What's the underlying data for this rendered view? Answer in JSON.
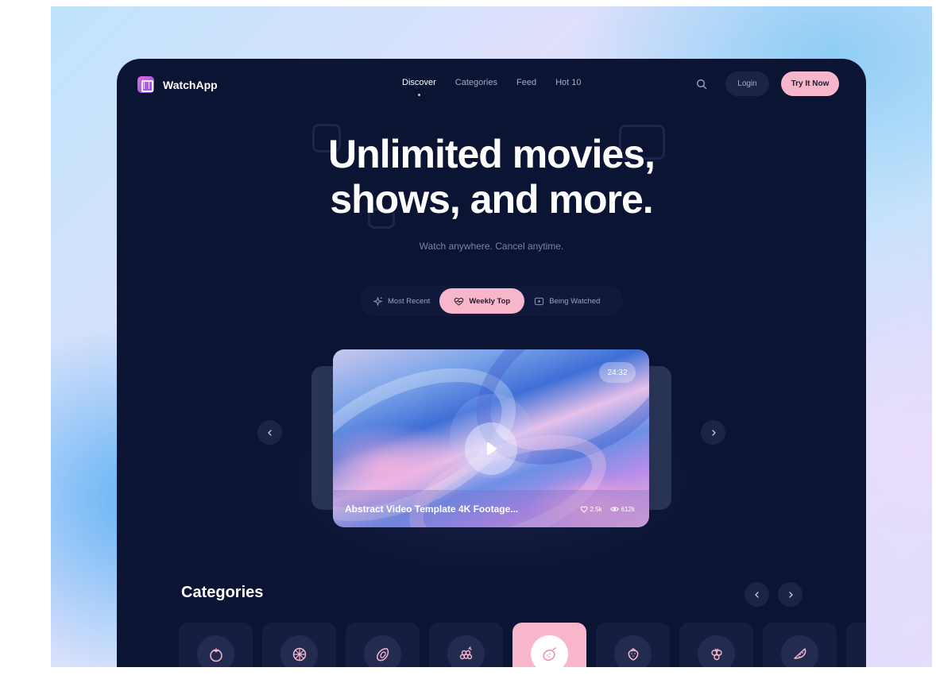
{
  "brand": {
    "name": "WatchApp",
    "icon": "film-icon"
  },
  "nav": {
    "items": [
      {
        "label": "Discover",
        "active": true
      },
      {
        "label": "Categories",
        "active": false
      },
      {
        "label": "Feed",
        "active": false
      },
      {
        "label": "Hot 10",
        "active": false
      }
    ],
    "search_icon": "search-icon",
    "login_label": "Login",
    "cta_label": "Try It Now"
  },
  "hero": {
    "title_line1": "Unlimited movies,",
    "title_line2": "shows, and more.",
    "subtitle": "Watch anywhere. Cancel anytime."
  },
  "filters": {
    "tabs": [
      {
        "label": "Most Recent",
        "icon": "sparkle-icon",
        "active": false
      },
      {
        "label": "Weekly Top",
        "icon": "heart-pulse-icon",
        "active": true
      },
      {
        "label": "Being Watched",
        "icon": "video-icon",
        "active": false
      }
    ]
  },
  "featured_video": {
    "title": "Abstract Video Template 4K Footage...",
    "duration": "24:32",
    "likes": "2.5k",
    "views": "612k"
  },
  "carousel": {
    "prev_icon": "chevron-left-icon",
    "next_icon": "chevron-right-icon"
  },
  "categories": {
    "title": "Categories",
    "cards": [
      {
        "icon": "tomato-icon",
        "active": false
      },
      {
        "icon": "orange-slice-icon",
        "active": false
      },
      {
        "icon": "papaya-icon",
        "active": false
      },
      {
        "icon": "grapes-icon",
        "active": false
      },
      {
        "icon": "kiwi-icon",
        "active": true
      },
      {
        "icon": "strawberry-icon",
        "active": false
      },
      {
        "icon": "berries-icon",
        "active": false
      },
      {
        "icon": "watermelon-icon",
        "active": false
      }
    ]
  },
  "colors": {
    "bg": "#0c1434",
    "accent": "#f8b6cb",
    "text": "#ffffff",
    "muted": "#a4abc8"
  }
}
